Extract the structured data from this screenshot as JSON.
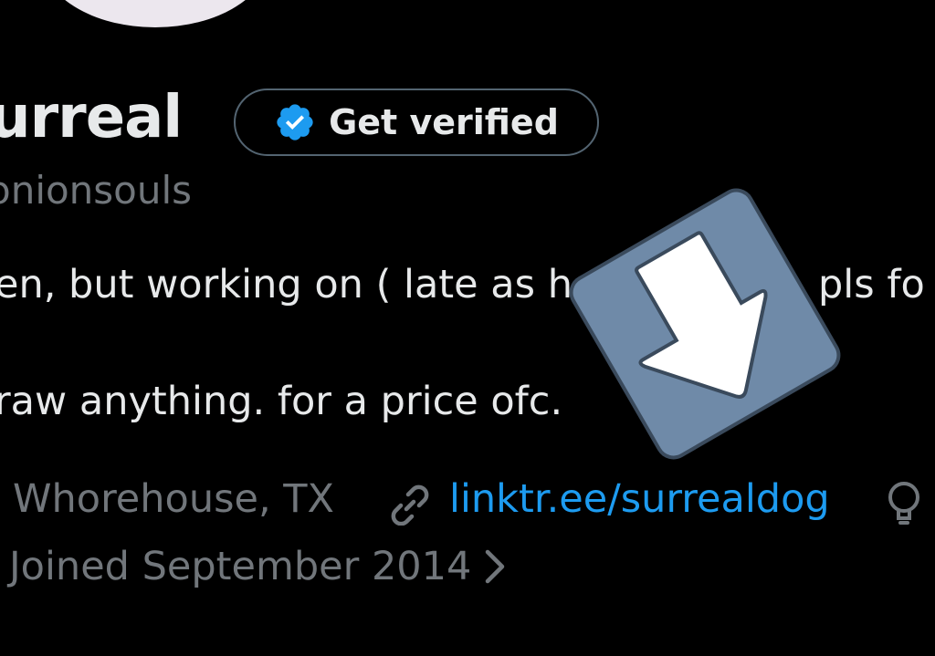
{
  "profile": {
    "display_name": "urreal",
    "handle": "onionsouls",
    "get_verified_label": "Get verified",
    "bio_line_1": "en, but working on ( late as h",
    "bio_line_1_tail": "pls fo",
    "bio_line_2": "raw anything. for a price ofc.",
    "location": "Whorehouse, TX",
    "link": "linktr.ee/surrealdog",
    "joined": "Joined September 2014"
  },
  "icons": {
    "verified": "verified-badge-icon",
    "link": "link-icon",
    "bulb": "lightbulb-icon",
    "chevron": "chevron-right-icon",
    "overlay": "download-arrow-icon"
  },
  "colors": {
    "background": "#000000",
    "text": "#e7e9ea",
    "secondary": "#71767b",
    "accent": "#1d9bf0",
    "overlay_tile": "#6f8aa8"
  }
}
